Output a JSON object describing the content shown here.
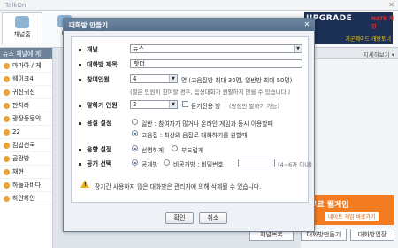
{
  "app": {
    "title": "TalkOn",
    "tabs": [
      {
        "label": "채널홈"
      },
      {
        "label": "대"
      }
    ],
    "banner": {
      "logo": "UPGRADE",
      "top_text": "NATE 게임",
      "sub_text": "기군제이드 개방토너"
    },
    "left_header": "뉴스  채널에 게",
    "left_list": [
      "마마아 / 게",
      "웨이크4",
      "귀신귀신",
      "판처라",
      "광장동등의",
      "22",
      "김밥천국",
      "골랑방",
      "채현",
      "하늘과바다",
      "하얀하얀"
    ],
    "right_header": "지세히보기 ▾",
    "right_banner": {
      "main": "무료 웹게임",
      "sub": "네이트 게임 바로가기"
    },
    "bottom_buttons": [
      "채널목록",
      "대화방만들기",
      "대화방입장"
    ]
  },
  "dialog": {
    "title": "대화방 만들기",
    "close": "✕",
    "channel": {
      "label": "채널",
      "value": "뉴스"
    },
    "room_title": {
      "label": "대화방 제목",
      "value": "핫더"
    },
    "capacity": {
      "label": "참여인원",
      "value": "4",
      "unit": "명 (고음질방 최대 30명, 일반방 최대 50명)",
      "note": "(많은 인원이 참여할 경우, 음성대화가 원활하지 않을 수 있습니다.)"
    },
    "speaking": {
      "label": "말하기 인원",
      "value": "2",
      "check_label": "듣기전용 방",
      "check_note": "(방장만 말하기 가능)"
    },
    "voice": {
      "label": "음질 설정",
      "options": [
        {
          "label": "일반 : 참여자가 많거나 온라인 게임과 동시 이용할때",
          "selected": false
        },
        {
          "label": "고음질 : 최상의 음질로 대화하기를 원할때",
          "selected": true
        }
      ]
    },
    "sound": {
      "label": "음향 설정",
      "options": [
        {
          "label": "선명하게",
          "selected": true
        },
        {
          "label": "부드럽게",
          "selected": false
        }
      ]
    },
    "visibility": {
      "label": "공개 선택",
      "options": [
        {
          "label": "공개방",
          "selected": true
        },
        {
          "label": "비공개방 : 비밀번호",
          "selected": false
        }
      ],
      "password_value": "",
      "password_hint": "(4~6자 이내)"
    },
    "warning": "장기간 사용하지 않은 대화방은 관리자에 의해 삭제될 수 있습니다.",
    "confirm": "확인",
    "cancel": "취소"
  }
}
